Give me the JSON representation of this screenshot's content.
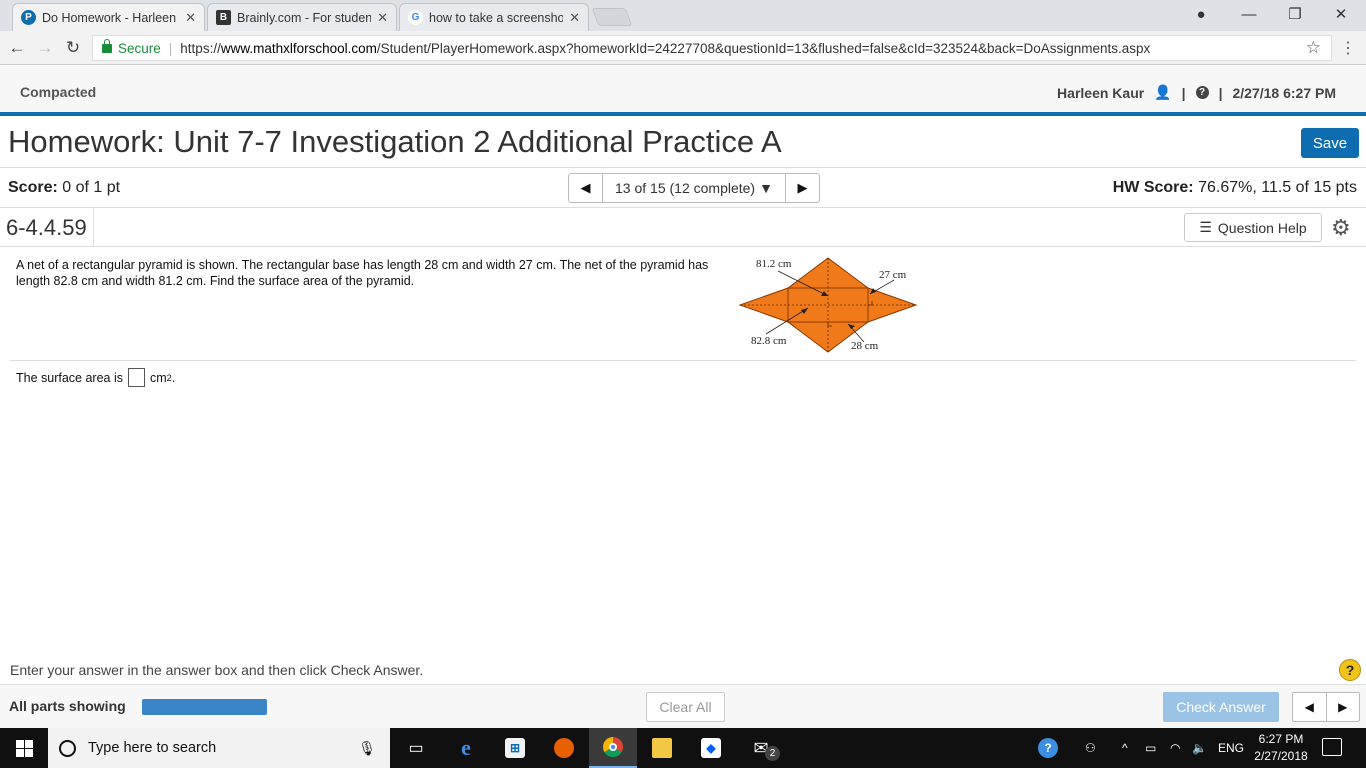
{
  "browser": {
    "tabs": [
      {
        "label": "Do Homework - Harleen",
        "favicon": "pearson-icon",
        "favicon_char": "P",
        "favicon_color": "#0d6db0"
      },
      {
        "label": "Brainly.com - For student",
        "favicon": "brainly-icon",
        "favicon_char": "B",
        "favicon_color": "#333333"
      },
      {
        "label": "how to take a screenshot",
        "favicon": "google-icon",
        "favicon_char": "G",
        "favicon_color": "#4285f4"
      }
    ],
    "secure_label": "Secure",
    "url_prefix": "https://",
    "url_host": "www.mathxlforschool.com",
    "url_path": "/Student/PlayerHomework.aspx?homeworkId=24227708&questionId=13&flushed=false&cId=323524&back=DoAssignments.aspx"
  },
  "header": {
    "compacted": "Compacted",
    "user": "Harleen Kaur",
    "separator": "|",
    "datetime": "2/27/18 6:27 PM"
  },
  "homework": {
    "title": "Homework: Unit 7-7 Investigation 2 Additional Practice A",
    "save_label": "Save",
    "score_label": "Score:",
    "score_value": " 0 of 1 pt",
    "pager_text": "13 of 15 (12 complete)",
    "hw_score_label": "HW Score:",
    "hw_score_value": " 76.67%, 11.5 of 15 pts",
    "question_id": "6-4.4.59",
    "question_help": "Question Help"
  },
  "question": {
    "text": "A net of a rectangular pyramid is shown. The rectangular base has length 28 cm and width 27 cm. The net of the pyramid has length 82.8 cm and width 81.2 cm. Find the surface area of the pyramid.",
    "figure_labels": {
      "width_net": "81.2 cm",
      "width_base": "27 cm",
      "length_net": "82.8 cm",
      "length_base": "28 cm"
    },
    "figure_color": "#f07a1a",
    "answer_prefix": "The surface area is",
    "answer_unit": "cm",
    "answer_exponent": "2",
    "answer_suffix": "."
  },
  "footer": {
    "instructions": "Enter your answer in the answer box and then click Check Answer.",
    "all_parts": "All parts showing",
    "clear_all": "Clear All",
    "check_answer": "Check Answer",
    "help_char": "?"
  },
  "taskbar": {
    "search_placeholder": "Type here to search",
    "language": "ENG",
    "time": "6:27 PM",
    "date": "2/27/2018",
    "mail_badge": "2"
  }
}
